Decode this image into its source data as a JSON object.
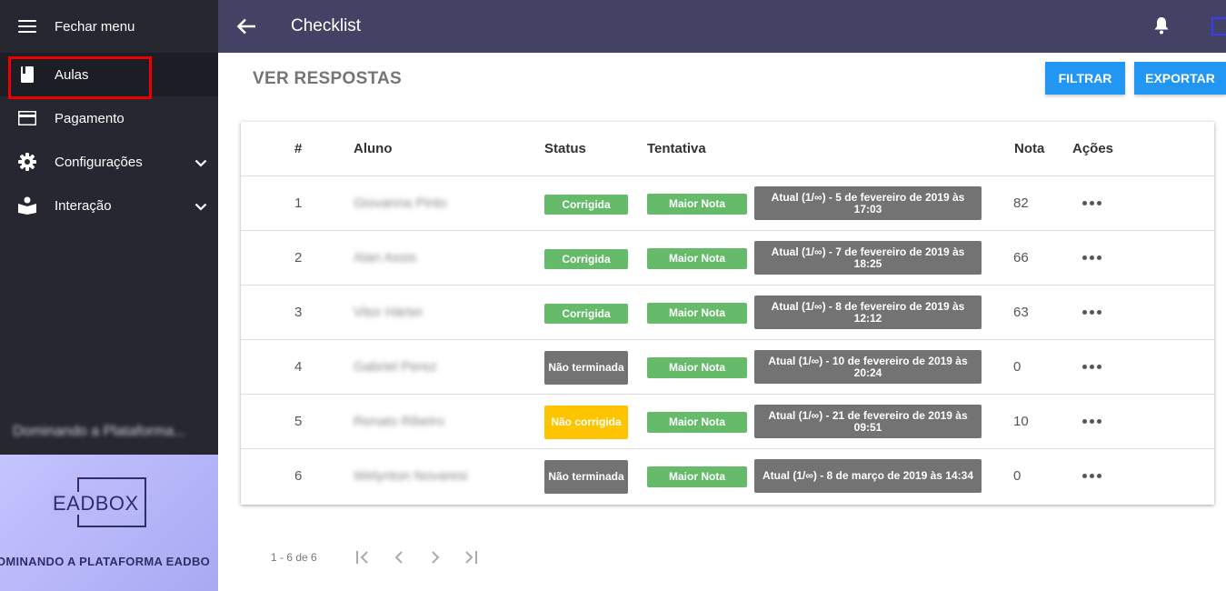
{
  "sidebar": {
    "close_menu_label": "Fechar menu",
    "items": [
      {
        "label": "Aulas",
        "icon": "book-icon"
      },
      {
        "label": "Pagamento",
        "icon": "credit-card-icon"
      },
      {
        "label": "Configurações",
        "icon": "gear-icon"
      },
      {
        "label": "Interação",
        "icon": "reader-icon"
      }
    ],
    "course_name": "Dominando a Plataforma...",
    "banner": {
      "logo": "EADBOX",
      "subtitle": "OMINANDO A PLATAFORMA EADBO"
    }
  },
  "topbar": {
    "title": "Checklist"
  },
  "page": {
    "title": "VER RESPOSTAS",
    "filter_label": "FILTRAR",
    "export_label": "EXPORTAR"
  },
  "table": {
    "headers": {
      "num": "#",
      "aluno": "Aluno",
      "status": "Status",
      "tentativa": "Tentativa",
      "nota": "Nota",
      "acoes": "Ações"
    },
    "rows": [
      {
        "num": "1",
        "aluno": "Giovanna Pinto",
        "status": "Corrigida",
        "tentativa": "Maior Nota",
        "atual": "Atual (1/∞) - 5 de fevereiro de 2019 às 17:03",
        "nota": "82"
      },
      {
        "num": "2",
        "aluno": "Alan Assis",
        "status": "Corrigida",
        "tentativa": "Maior Nota",
        "atual": "Atual (1/∞) - 7 de fevereiro de 2019 às 18:25",
        "nota": "66"
      },
      {
        "num": "3",
        "aluno": "Vitor Härter",
        "status": "Corrigida",
        "tentativa": "Maior Nota",
        "atual": "Atual (1/∞) - 8 de fevereiro de 2019 às 12:12",
        "nota": "63"
      },
      {
        "num": "4",
        "aluno": "Gabriel Perez",
        "status": "Não terminada",
        "tentativa": "Maior Nota",
        "atual": "Atual (1/∞) - 10 de fevereiro de 2019 às 20:24",
        "nota": "0"
      },
      {
        "num": "5",
        "aluno": "Renato Ribeiro",
        "status": "Não corrigida",
        "tentativa": "Maior Nota",
        "atual": "Atual (1/∞) - 21 de fevereiro de 2019 às 09:51",
        "nota": "10"
      },
      {
        "num": "6",
        "aluno": "Welynton Novaresi",
        "status": "Não terminada",
        "tentativa": "Maior Nota",
        "atual": "Atual (1/∞) - 8 de março de 2019 às 14:34",
        "nota": "0"
      }
    ]
  },
  "pagination": {
    "info": "1 - 6 de 6"
  },
  "colors": {
    "sidebar": "#272731",
    "topbar": "#434264",
    "accent": "#2196f3",
    "success": "#66bb6a",
    "warning": "#ffc400",
    "neutral": "#737373"
  }
}
